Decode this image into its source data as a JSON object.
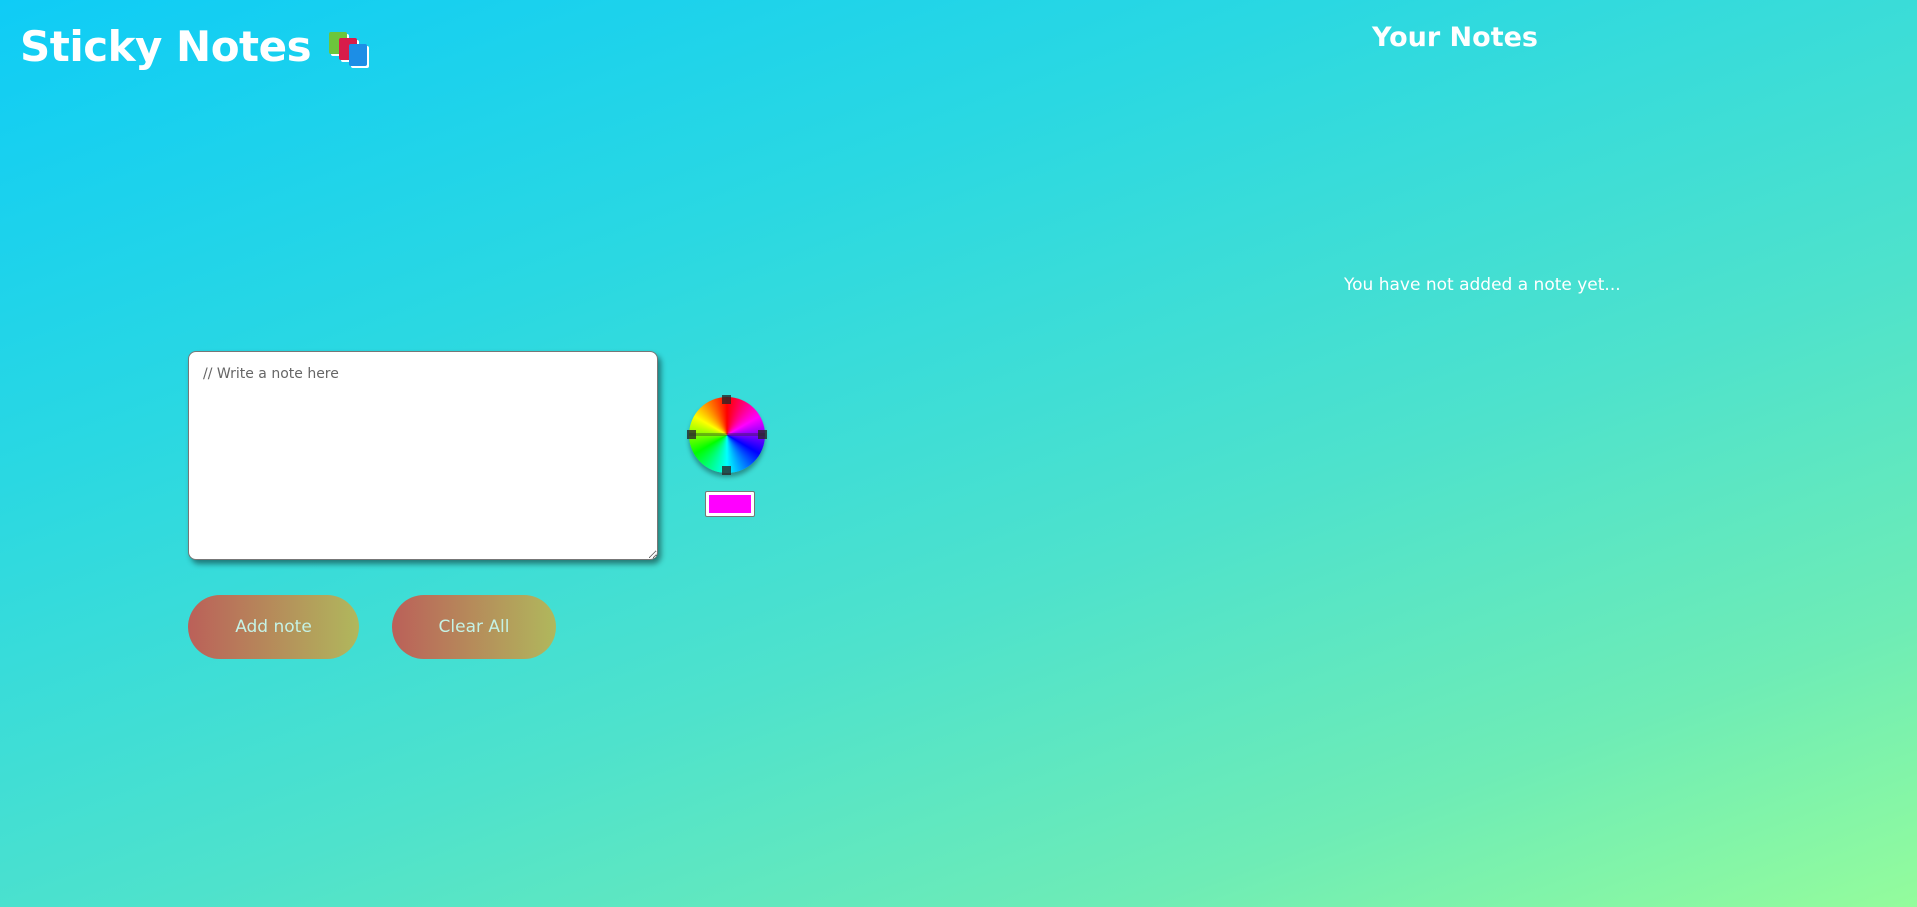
{
  "header": {
    "title": "Sticky Notes",
    "icon": "books-icon"
  },
  "notes_panel": {
    "heading": "Your Notes",
    "empty_message": "You have not added a note yet..."
  },
  "editor": {
    "placeholder": "// Write a note here",
    "value": ""
  },
  "color_picker": {
    "icon": "color-wheel-icon",
    "selected_color": "#ff00ff"
  },
  "actions": {
    "add_label": "Add note",
    "clear_label": "Clear All"
  },
  "colors": {
    "background_start": "#0fccf6",
    "background_end": "#94fc9c",
    "button_start": "#bb6059",
    "button_end": "#b0b85c",
    "button_text": "#c5f2e5"
  }
}
